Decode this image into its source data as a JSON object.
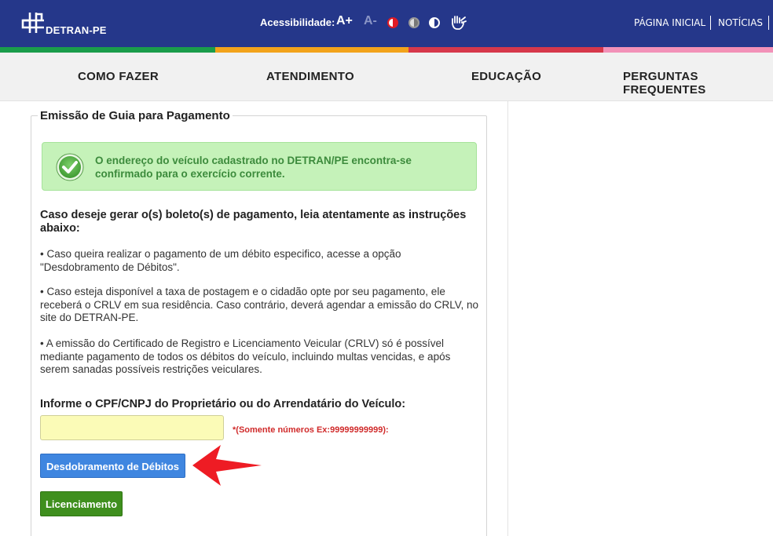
{
  "header": {
    "logo_text": "DETRAN-PE",
    "accessibility_label": "Acessibilidade:",
    "font_increase": "A+",
    "font_decrease": "A-",
    "links": [
      "PÁGINA INICIAL",
      "NOTÍCIAS"
    ]
  },
  "nav": {
    "items": [
      "COMO FAZER",
      "ATENDIMENTO",
      "EDUCAÇÃO",
      "PERGUNTAS FREQUENTES"
    ]
  },
  "form": {
    "title": "Emissão de Guia para Pagamento",
    "alert_text": "O endereço do veículo cadastrado no DETRAN/PE encontra-se confirmado para o exercício corrente.",
    "instructions_title": "Caso deseje gerar o(s) boleto(s) de pagamento, leia atentamente as instruções abaixo:",
    "bullets": [
      "• Caso queira realizar o pagamento de um débito especifico, acesse a opção \"Desdobramento de Débitos\".",
      "• Caso esteja disponível a taxa de postagem e o cidadão opte por seu pagamento, ele receberá o CRLV em sua residência. Caso contrário, deverá agendar a emissão do CRLV, no site do DETRAN-PE.",
      "• A emissão do Certificado de Registro e Licenciamento Veicular (CRLV) só é possível mediante pagamento de todos os débitos do veículo, incluindo multas vencidas, e após serem sanadas possíveis restrições veiculares."
    ],
    "cpf_label": "Informe o CPF/CNPJ do Proprietário ou do Arrendatário do Veículo:",
    "cpf_value": "",
    "cpf_hint": "*(Somente números Ex:99999999999):",
    "btn_desdobramento": "Desdobramento de Débitos",
    "btn_licenciamento": "Licenciamento"
  },
  "colors": {
    "header_bg": "#25378a",
    "stripe": [
      "#1a9c4b",
      "#f2a31b",
      "#d6384b",
      "#f291b8"
    ],
    "alert_bg": "#c5f2b9",
    "btn_blue": "#3f86e0",
    "btn_green": "#3f8f1e",
    "arrow": "#ee1c24"
  },
  "icons": [
    "detran-logo-icon",
    "contrast-icon",
    "grayscale-icon",
    "invert-icon",
    "sign-language-icon",
    "check-icon",
    "red-arrow-icon"
  ]
}
